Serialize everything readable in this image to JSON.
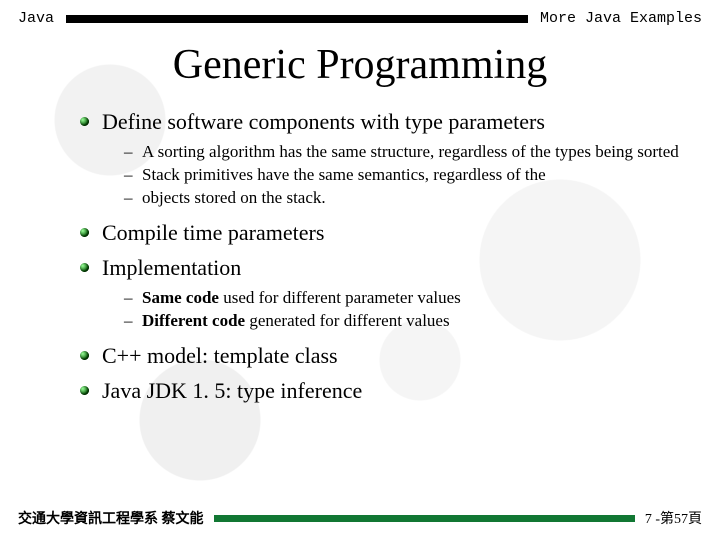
{
  "header": {
    "left": "Java",
    "right": "More Java Examples"
  },
  "title": "Generic Programming",
  "bullets": {
    "b1": "Define software components with type parameters",
    "b1_sub": {
      "s1": "A sorting algorithm has the same structure, regardless of the types being sorted",
      "s2": "Stack primitives have the same semantics, regardless of the",
      "s3": "objects stored on the stack."
    },
    "b2": "Compile time parameters",
    "b3": "Implementation",
    "b3_sub": {
      "s1_bold": "Same code",
      "s1_rest": " used for different parameter values",
      "s2_bold": "Different code",
      "s2_rest": " generated for different values"
    },
    "b4": "C++ model: template class",
    "b5": "Java JDK 1. 5: type inference"
  },
  "footer": {
    "left": "交通大學資訊工程學系 蔡文能",
    "right": "7 -第57頁"
  }
}
